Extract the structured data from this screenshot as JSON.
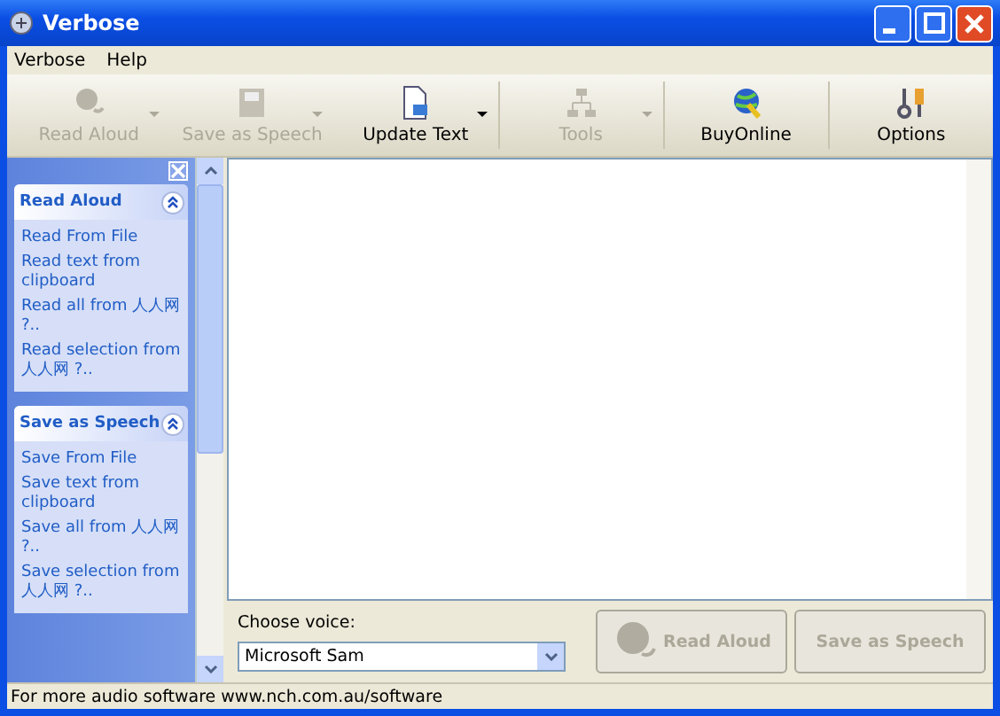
{
  "window": {
    "title": "Verbose"
  },
  "menu": [
    "Verbose",
    "Help"
  ],
  "toolbar": [
    {
      "label": "Read Aloud",
      "kind": "speaker",
      "disabled": true,
      "dropdown": true
    },
    {
      "label": "Save as Speech",
      "kind": "disk",
      "disabled": true,
      "dropdown": true
    },
    {
      "label": "Update Text",
      "kind": "document",
      "disabled": false,
      "dropdown": true
    },
    {
      "label": "Tools",
      "kind": "tree",
      "disabled": true,
      "dropdown": true
    },
    {
      "label": "BuyOnline",
      "kind": "globe",
      "disabled": false,
      "dropdown": false
    },
    {
      "label": "Options",
      "kind": "tools",
      "disabled": false,
      "dropdown": false
    }
  ],
  "task_panes": [
    {
      "title": "Read Aloud",
      "expanded": true,
      "items": [
        "Read From File",
        "Read text from clipboard",
        "Read all from 人人网 ?..",
        "Read selection from 人人网 ?.."
      ]
    },
    {
      "title": "Save as Speech",
      "expanded": true,
      "items": [
        "Save From File",
        "Save text from clipboard",
        "Save all from 人人网 ?..",
        "Save selection from 人人网 ?.."
      ]
    }
  ],
  "voice": {
    "label": "Choose voice:",
    "value": "Microsoft Sam"
  },
  "buttons": [
    {
      "label": "Read Aloud",
      "disabled": true
    },
    {
      "label": "Save as Speech",
      "disabled": true
    }
  ],
  "status_bar": "For more audio software www.nch.com.au/software"
}
